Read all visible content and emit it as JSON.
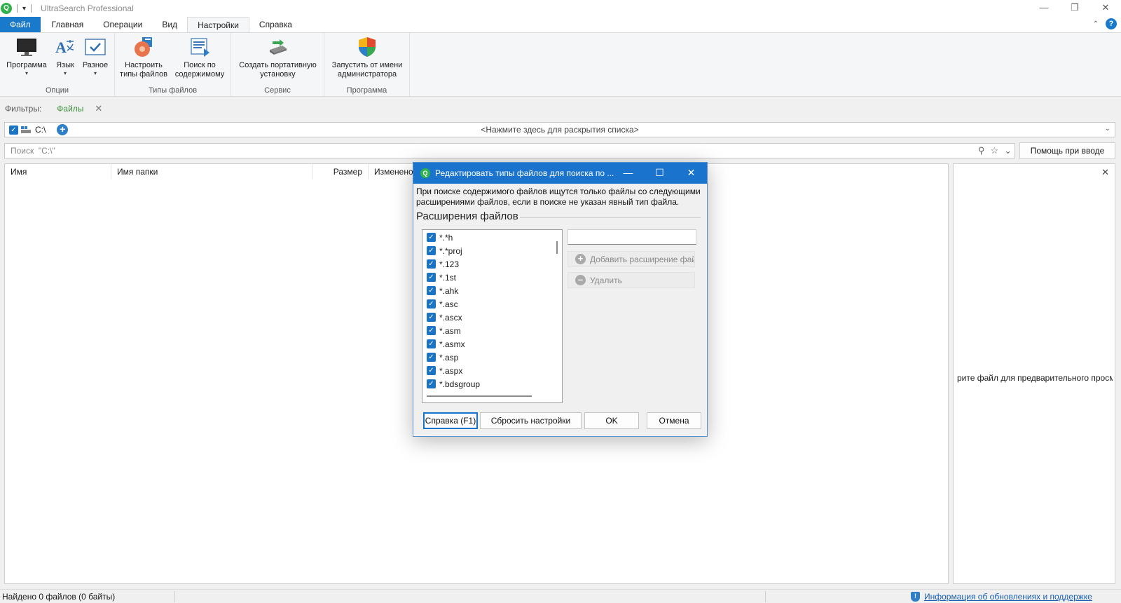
{
  "app": {
    "title": "UltraSearch Professional",
    "qat_dropdown": "▾",
    "logo_glyph": "Q",
    "controls": {
      "minimize": "—",
      "restore": "❐",
      "close": "✕"
    }
  },
  "ribbon": {
    "tabs": [
      "Файл",
      "Главная",
      "Операции",
      "Вид",
      "Настройки",
      "Справка"
    ],
    "active_tab": "Настройки",
    "collapse_glyph": "⌃",
    "help_glyph": "?",
    "groups": [
      {
        "label": "Опции",
        "buttons": [
          {
            "label": "Программа",
            "icon": "monitor-icon",
            "has_dropdown": true
          },
          {
            "label": "Язык",
            "icon": "language-icon",
            "has_dropdown": true
          },
          {
            "label": "Разное",
            "icon": "checkbox-window-icon",
            "has_dropdown": true
          }
        ]
      },
      {
        "label": "Типы файлов",
        "buttons": [
          {
            "label_line1": "Настроить",
            "label_line2": "типы файлов",
            "icon": "file-types-icon"
          },
          {
            "label_line1": "Поиск по",
            "label_line2": "содержимому",
            "icon": "content-search-icon"
          }
        ]
      },
      {
        "label": "Сервис",
        "buttons": [
          {
            "label_line1": "Создать портативную",
            "label_line2": "установку",
            "icon": "usb-drive-icon"
          }
        ]
      },
      {
        "label": "Программа",
        "buttons": [
          {
            "label_line1": "Запустить от имени",
            "label_line2": "администратора",
            "icon": "uac-shield-icon"
          }
        ]
      }
    ]
  },
  "filters": {
    "label": "Фильтры:",
    "active_filter": "Файлы",
    "remove_glyph": "✕"
  },
  "drives": {
    "selected": "C:\\",
    "hint": "<Нажмите здесь для раскрытия списка>",
    "add_glyph": "+",
    "check_glyph": "✓",
    "arrow_glyph": "⌄"
  },
  "search": {
    "placeholder": "Поиск  \"C:\\\"",
    "help_button": "Помощь при вводе",
    "search_glyph": "⚲",
    "star_glyph": "☆",
    "dropdown_glyph": "⌄"
  },
  "results": {
    "columns": [
      "Имя",
      "Имя папки",
      "Размер",
      "Изменено"
    ]
  },
  "preview": {
    "close_glyph": "✕",
    "hint": "рите файл для предварительного просм"
  },
  "status": {
    "count": "Найдено 0 файлов (0 байты)",
    "link": "Информация об обновлениях и поддержке",
    "shield_glyph": "!"
  },
  "dialog": {
    "title": "Редактировать типы файлов для поиска по ...",
    "controls": {
      "minimize": "—",
      "maximize": "☐",
      "close": "✕"
    },
    "description": "При поиске содержимого файлов ищутся только файлы со следующими расширениями файлов, если в поиске не указан явный тип файла.",
    "section": "Расширения файлов",
    "extensions": [
      "*.*h",
      "*.*proj",
      "*.123",
      "*.1st",
      "*.ahk",
      "*.asc",
      "*.ascx",
      "*.asm",
      "*.asmx",
      "*.asp",
      "*.aspx",
      "*.bdsgroup"
    ],
    "new_extension_value": "",
    "add_button": "Добавить расширение фай",
    "delete_button": "Удалить",
    "add_glyph": "+",
    "delete_glyph": "–",
    "buttons": {
      "help": "Справка (F1)",
      "reset": "Сбросить настройки",
      "ok": "OK",
      "cancel": "Отмена"
    }
  },
  "colors": {
    "accent": "#1a73cc",
    "file_tab": "#1979ca",
    "filter_green": "#3d8e3d",
    "link": "#1a5fb4"
  }
}
